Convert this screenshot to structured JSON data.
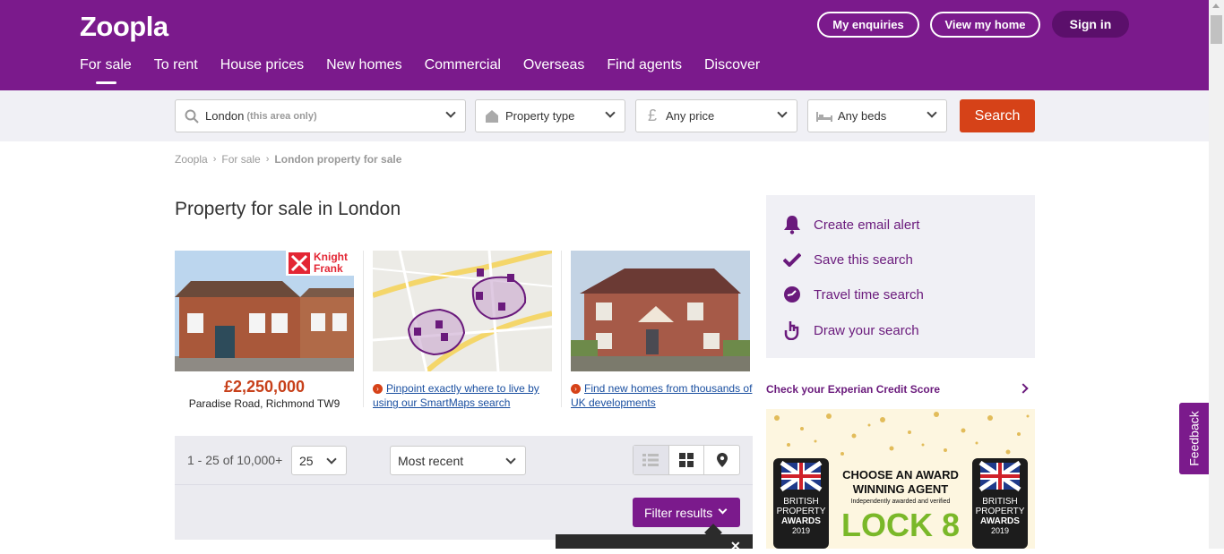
{
  "header": {
    "logo": "Zoopla",
    "buttons": {
      "enquiries": "My enquiries",
      "view_home": "View my home",
      "sign_in": "Sign in"
    },
    "nav": [
      "For sale",
      "To rent",
      "House prices",
      "New homes",
      "Commercial",
      "Overseas",
      "Find agents",
      "Discover"
    ],
    "active_nav": "For sale",
    "brand_color": "#7b1a8c"
  },
  "search": {
    "location": "London",
    "location_hint": "(this area only)",
    "property_type": "Property type",
    "price": "Any price",
    "beds": "Any beds",
    "button": "Search",
    "button_color": "#d64218"
  },
  "breadcrumb": {
    "items": [
      "Zoopla",
      "For sale",
      "London property for sale"
    ]
  },
  "page_title": "Property for sale in London",
  "cards": {
    "featured": {
      "agent": "Knight Frank",
      "agent_line1": "Knight",
      "agent_line2": "Frank",
      "price": "£2,250,000",
      "address": "Paradise Road, Richmond TW9"
    },
    "smartmaps_link": "Pinpoint exactly where to live by using our SmartMaps search",
    "newhomes_link": "Find new homes from thousands of UK developments"
  },
  "results": {
    "count": "1 - 25 of 10,000+",
    "per_page": "25",
    "sort": "Most recent",
    "filter_button": "Filter results"
  },
  "sidebar": {
    "actions": [
      "Create email alert",
      "Save this search",
      "Travel time search",
      "Draw your search"
    ],
    "experian": "Check your Experian Credit Score",
    "ad": {
      "headline1": "CHOOSE AN AWARD",
      "headline2": "WINNING AGENT",
      "subline": "Independently awarded and verified",
      "brand": "LOCK 8",
      "badge_line1": "BRITISH",
      "badge_line2": "PROPERTY",
      "badge_line3": "AWARDS",
      "badge_year": "2019"
    }
  },
  "feedback": "Feedback"
}
